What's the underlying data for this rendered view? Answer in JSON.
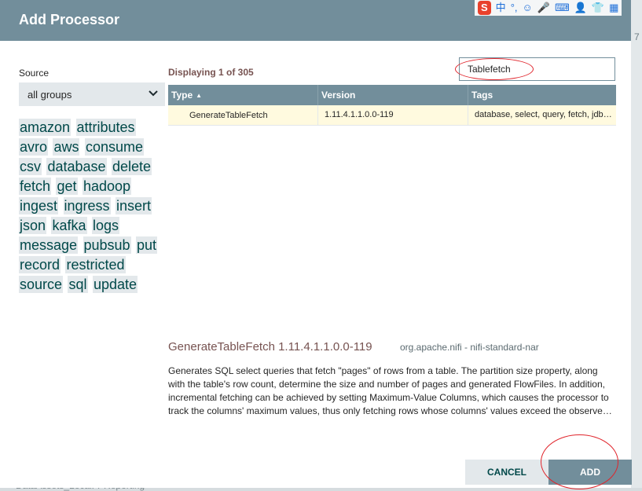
{
  "dialog": {
    "title": "Add Processor"
  },
  "background": {
    "bottom_text": "DataAssets_LocalFPReporting",
    "side_mark": "7"
  },
  "tray": {
    "items": [
      "S",
      "中",
      "°,",
      "☺",
      "🎤",
      "⌨",
      "👤",
      "👕",
      "▦"
    ]
  },
  "source": {
    "label": "Source",
    "selected": "all groups"
  },
  "tags": [
    "amazon",
    "attributes",
    "avro",
    "aws",
    "consume",
    "csv",
    "database",
    "delete",
    "fetch",
    "get",
    "hadoop",
    "ingest",
    "ingress",
    "insert",
    "json",
    "kafka",
    "logs",
    "message",
    "pubsub",
    "put",
    "record",
    "restricted",
    "source",
    "sql",
    "update"
  ],
  "listing": {
    "displaying": "Displaying 1 of 305"
  },
  "filter": {
    "value": "Tablefetch"
  },
  "table": {
    "columns": [
      "Type",
      "Version",
      "Tags"
    ],
    "rows": [
      {
        "type": "GenerateTableFetch",
        "version": "1.11.4.1.1.0.0-119",
        "tags": "database, select, query, fetch, jdbc, sql, generate"
      }
    ]
  },
  "selected": {
    "title": "GenerateTableFetch 1.11.4.1.1.0.0-119",
    "bundle": "org.apache.nifi - nifi-standard-nar",
    "description": "Generates SQL select queries that fetch \"pages\" of rows from a table. The partition size property, along with the table's row count, determine the size and number of pages and generated FlowFiles. In addition, incremental fetching can be achieved by setting Maximum-Value Columns, which causes the processor to track the columns' maximum values, thus only fetching rows whose columns' values exceed the observed maximums."
  },
  "buttons": {
    "cancel": "CANCEL",
    "add": "ADD"
  },
  "colors": {
    "header": "#728e9b",
    "tag_bg": "#e3e8eb",
    "tag_text": "#004849",
    "accent_text": "#775351",
    "selected_row": "#fffadf",
    "annotation": "#e0242b"
  }
}
